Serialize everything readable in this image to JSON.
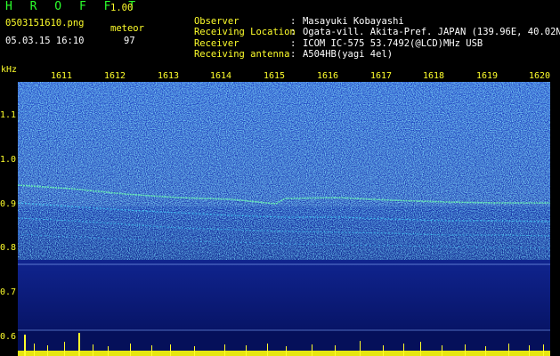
{
  "header": {
    "app_title": "H R O F F T",
    "version": "1.00",
    "file_name": "0503151610.png",
    "date_time": "05.03.15 16:10",
    "meteor_label": "meteor",
    "meteor_count": "97"
  },
  "info": [
    {
      "label": "Observer",
      "sep": ":",
      "value": "Masayuki Kobayashi"
    },
    {
      "label": "Receiving Location",
      "sep": ":",
      "value": "Ogata-vill. Akita-Pref. JAPAN (139.96E, 40.02N)"
    },
    {
      "label": "Receiver",
      "sep": ":",
      "value": "ICOM IC-575 53.7492(@LCD)MHz USB"
    },
    {
      "label": "Receiving antenna",
      "sep": ":",
      "value": "A504HB(yagi 4el)"
    }
  ],
  "axis": {
    "y_unit": "kHz",
    "y_ticks": [
      "1.1",
      "1.0",
      "0.9",
      "0.8",
      "0.7",
      "0.6"
    ],
    "x_ticks": [
      "1611",
      "1612",
      "1613",
      "1614",
      "1615",
      "1616",
      "1617",
      "1618",
      "1619",
      "1620"
    ]
  },
  "colors": {
    "label": "#2bff2b",
    "value": "#ffff2b",
    "text": "#ffffff",
    "background": "#000000",
    "noise_floor": "#0a1a8a"
  }
}
